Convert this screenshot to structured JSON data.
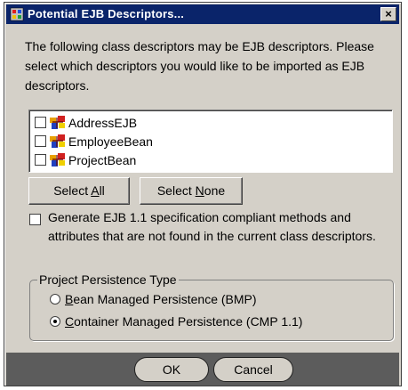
{
  "dialog": {
    "title": "Potential EJB Descriptors...",
    "close_glyph": "×"
  },
  "intro": "The following class descriptors may be EJB descriptors. Please select which descriptors you would like to be imported as EJB descriptors.",
  "descriptors": [
    {
      "label": "AddressEJB",
      "checked": false,
      "icon": "ejb-descriptor-icon"
    },
    {
      "label": "EmployeeBean",
      "checked": false,
      "icon": "ejb-descriptor-icon"
    },
    {
      "label": "ProjectBean",
      "checked": false,
      "icon": "ejb-descriptor-icon"
    }
  ],
  "buttons": {
    "select_all": {
      "before": "Select ",
      "mnemonic": "A",
      "after": "ll"
    },
    "select_none": {
      "before": "Select ",
      "mnemonic": "N",
      "after": "one"
    },
    "ok": "OK",
    "cancel": "Cancel"
  },
  "generate_option": {
    "label": "Generate EJB 1.1 specification compliant methods and attributes that are not found in the current class descriptors.",
    "checked": false
  },
  "persistence": {
    "legend": "Project Persistence Type",
    "options": [
      {
        "mnemonic": "B",
        "rest": "ean Managed Persistence (BMP)",
        "selected": false
      },
      {
        "mnemonic": "C",
        "rest": "ontainer Managed Persistence (CMP 1.1)",
        "selected": true
      }
    ]
  },
  "colors": {
    "title_bar": "#0a246a",
    "dialog_face": "#d4d0c8",
    "button_bar": "#5c5c5c"
  }
}
